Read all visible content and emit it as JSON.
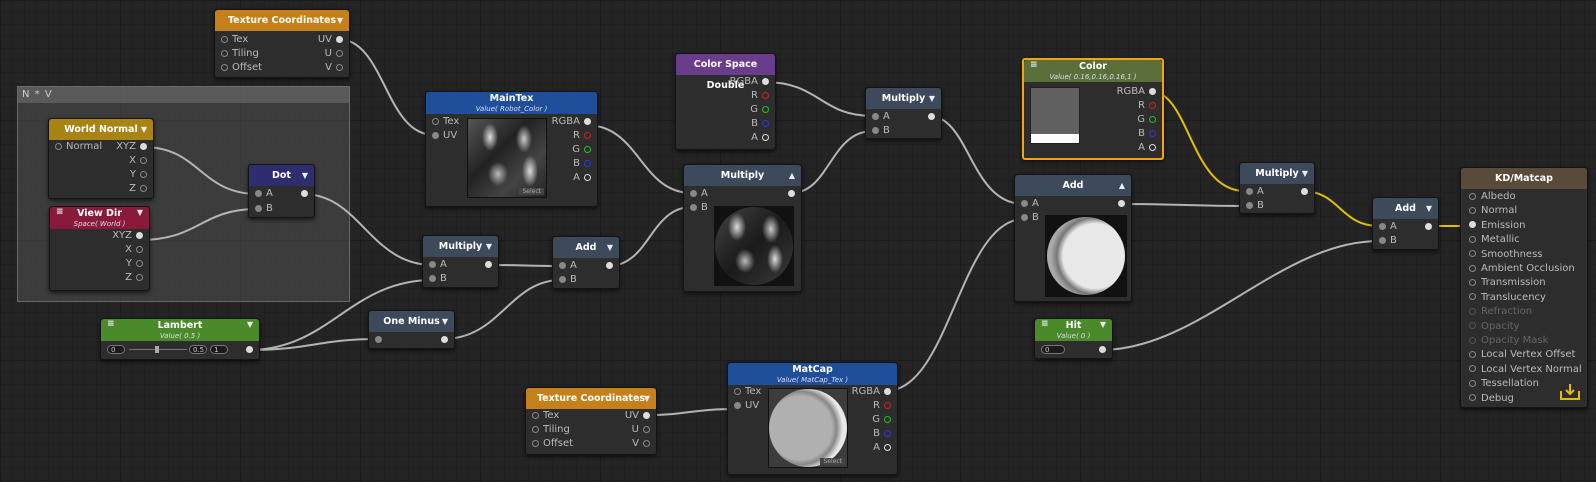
{
  "group": {
    "title": "N * V"
  },
  "nodes": {
    "tc1": {
      "title": "Texture Coordinates",
      "inputs": [
        "Tex",
        "Tiling",
        "Offset"
      ],
      "outputs": [
        "UV",
        "U",
        "V"
      ]
    },
    "worldNormal": {
      "title": "World Normal",
      "input": "Normal",
      "outputs": [
        "XYZ",
        "X",
        "Y",
        "Z"
      ]
    },
    "viewDir": {
      "title": "View Dir",
      "sub": "Space( World )",
      "outputs": [
        "XYZ",
        "X",
        "Y",
        "Z"
      ]
    },
    "dot": {
      "title": "Dot",
      "inputs": [
        "A",
        "B"
      ]
    },
    "lambert": {
      "title": "Lambert",
      "sub": "Value( 0.5 )",
      "min": "0",
      "val": "0.5",
      "max": "1"
    },
    "oneMinus": {
      "title": "One Minus"
    },
    "multiply1": {
      "title": "Multiply",
      "inputs": [
        "A",
        "B"
      ]
    },
    "add1": {
      "title": "Add",
      "inputs": [
        "A",
        "B"
      ]
    },
    "mainTex": {
      "title": "MainTex",
      "sub": "Value( Robot_Color )",
      "inputs": [
        "Tex",
        "UV"
      ],
      "outputs": [
        "RGBA",
        "R",
        "G",
        "B",
        "A"
      ],
      "select": "Select"
    },
    "colorSpace": {
      "title": "Color Space Double",
      "outputs": [
        "RGBA",
        "R",
        "G",
        "B",
        "A"
      ]
    },
    "multiply2": {
      "title": "Multiply",
      "inputs": [
        "A",
        "B"
      ]
    },
    "multiply3": {
      "title": "Multiply",
      "inputs": [
        "A",
        "B"
      ]
    },
    "color": {
      "title": "Color",
      "sub": "Value( 0.16,0.16,0.16,1 )",
      "outputs": [
        "RGBA",
        "R",
        "G",
        "B",
        "A"
      ]
    },
    "add2": {
      "title": "Add",
      "inputs": [
        "A",
        "B"
      ]
    },
    "multiply4": {
      "title": "Multiply",
      "inputs": [
        "A",
        "B"
      ]
    },
    "add3": {
      "title": "Add",
      "inputs": [
        "A",
        "B"
      ]
    },
    "hit": {
      "title": "Hit",
      "sub": "Value( 0 )",
      "val": "0"
    },
    "tc2": {
      "title": "Texture Coordinates",
      "inputs": [
        "Tex",
        "Tiling",
        "Offset"
      ],
      "outputs": [
        "UV",
        "U",
        "V"
      ]
    },
    "matcap": {
      "title": "MatCap",
      "sub": "Value( MatCap_Tex )",
      "inputs": [
        "Tex",
        "UV"
      ],
      "outputs": [
        "RGBA",
        "R",
        "G",
        "B",
        "A"
      ],
      "select": "Select"
    },
    "master": {
      "title": "KD/Matcap",
      "inputs": [
        "Albedo",
        "Normal",
        "Emission",
        "Metallic",
        "Smoothness",
        "Ambient Occlusion",
        "Transmission",
        "Translucency",
        "Refraction",
        "Opacity",
        "Opacity Mask",
        "Local Vertex Offset",
        "Local Vertex Normal",
        "Tessellation",
        "Debug"
      ],
      "disabled": [
        "Refraction",
        "Opacity",
        "Opacity Mask"
      ]
    }
  },
  "colors": {
    "wire": "#b4b4b4",
    "wireYellow": "#e0c000",
    "selection": "#f4a40c"
  }
}
